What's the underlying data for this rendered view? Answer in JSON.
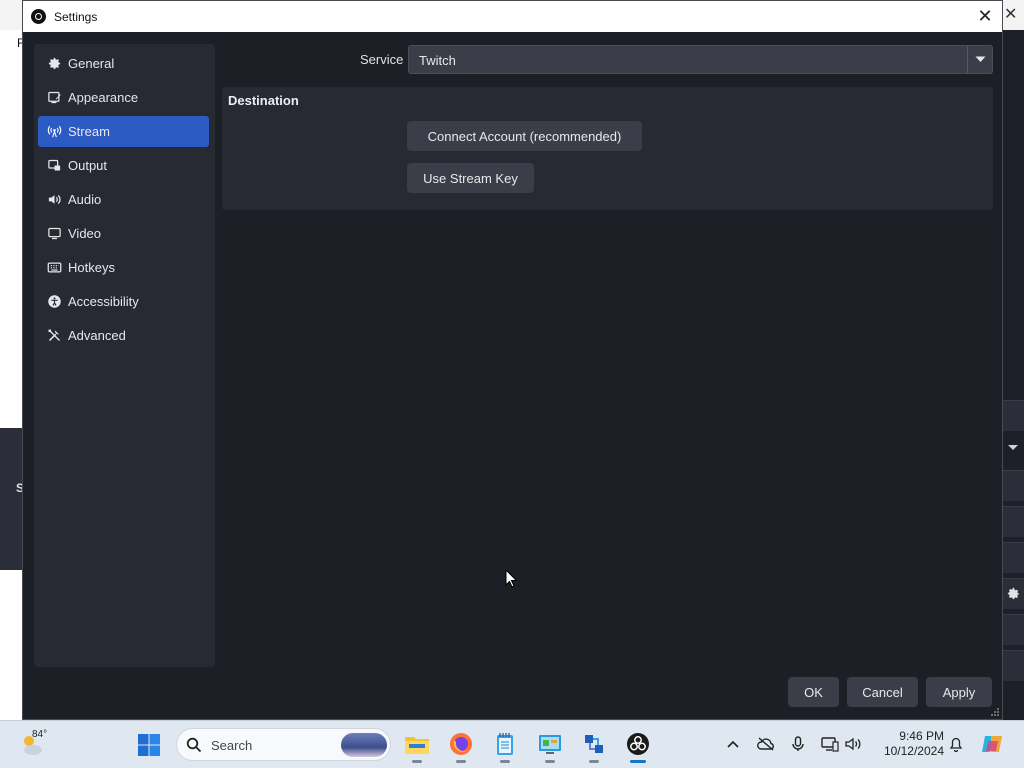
{
  "dialog": {
    "title": "Settings"
  },
  "sidebar": {
    "items": [
      {
        "label": "General",
        "icon": "gear-icon",
        "active": false
      },
      {
        "label": "Appearance",
        "icon": "appearance-icon",
        "active": false
      },
      {
        "label": "Stream",
        "icon": "broadcast-icon",
        "active": true
      },
      {
        "label": "Output",
        "icon": "output-icon",
        "active": false
      },
      {
        "label": "Audio",
        "icon": "speaker-icon",
        "active": false
      },
      {
        "label": "Video",
        "icon": "monitor-icon",
        "active": false
      },
      {
        "label": "Hotkeys",
        "icon": "keyboard-icon",
        "active": false
      },
      {
        "label": "Accessibility",
        "icon": "accessibility-icon",
        "active": false
      },
      {
        "label": "Advanced",
        "icon": "tools-icon",
        "active": false
      }
    ]
  },
  "stream": {
    "service_label": "Service",
    "service_value": "Twitch",
    "destination_title": "Destination",
    "connect_button": "Connect Account (recommended)",
    "stream_key_button": "Use Stream Key"
  },
  "footer": {
    "ok": "OK",
    "cancel": "Cancel",
    "apply": "Apply"
  },
  "taskbar": {
    "weather_temp": "84°",
    "search_placeholder": "Search",
    "time": "9:46 PM",
    "date": "10/12/2024"
  },
  "colors": {
    "accent": "#2d5bc4",
    "dialog_bg": "#1d1f26",
    "panel_bg": "#272a33",
    "button_bg": "#3b3e48"
  }
}
